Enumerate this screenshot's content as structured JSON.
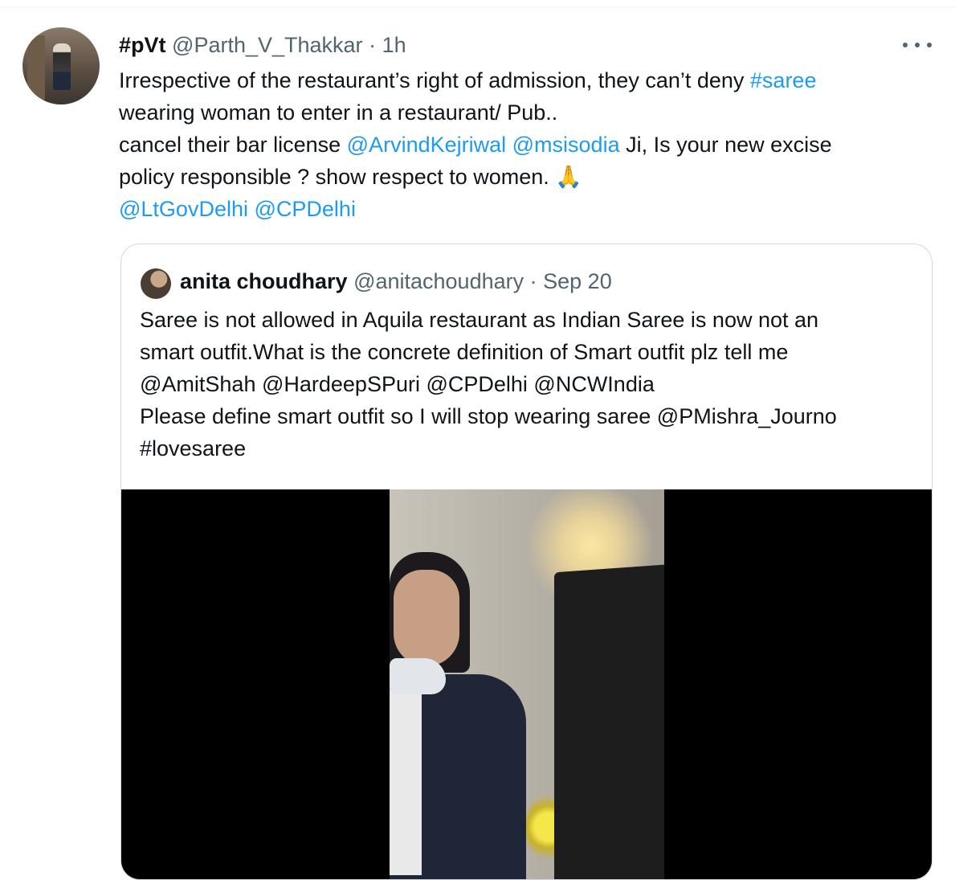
{
  "tweet": {
    "author_name": "#pVt",
    "author_handle": "@Parth_V_Thakkar",
    "separator": "·",
    "time": "1h",
    "more_icon": "more-horizontal-icon",
    "lines": [
      [
        "Irrespective of the restaurant’s right of admission, they can’t deny ",
        "#saree"
      ],
      "wearing woman to enter in a restaurant/ Pub..",
      [
        "cancel their bar license ",
        "@ArvindKejriwal",
        " ",
        "@msisodia",
        " Ji, Is your new excise"
      ],
      "policy responsible ? show respect to women. 🙏",
      [
        "@LtGovDelhi",
        " ",
        "@CPDelhi"
      ]
    ]
  },
  "quote": {
    "author_name": "anita choudhary",
    "author_handle": "@anitachoudhary",
    "separator": "·",
    "date": "Sep 20",
    "lines": [
      "Saree is not allowed in Aquila restaurant as Indian Saree is now not an",
      "smart outfit.What is the concrete definition of Smart outfit plz tell me",
      "@AmitShah @HardeepSPuri @CPDelhi @NCWIndia",
      "Please define smart outfit so I will stop wearing saree @PMishra_Journo",
      "#lovesaree"
    ]
  },
  "colors": {
    "text": "#0f1419",
    "secondary": "#536471",
    "link": "#1d9bf0",
    "border": "#cfd9de",
    "media_bg": "#000000"
  }
}
